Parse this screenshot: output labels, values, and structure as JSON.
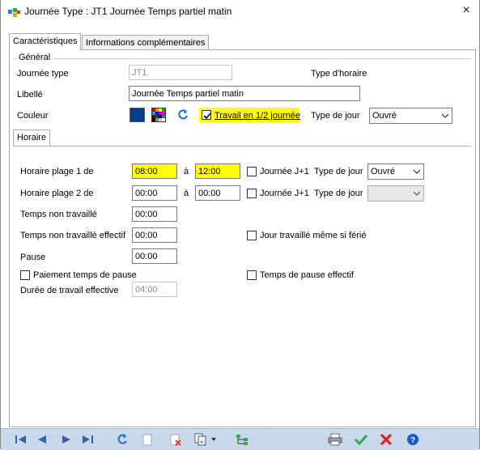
{
  "window": {
    "title": "Journée Type : JT1 Journée Temps partiel matin",
    "close_glyph": "×"
  },
  "tabs": [
    {
      "label": "Caractéristiques",
      "active": true
    },
    {
      "label": "Informations complémentaires",
      "active": false
    }
  ],
  "general": {
    "legend": "Général",
    "journee_type_label": "Journée type",
    "journee_type_value": "JT1",
    "type_horaire_label": "Type d'horaire",
    "libelle_label": "Libellé",
    "libelle_value": "Journée Temps partiel matin",
    "couleur_label": "Couleur",
    "couleur_value": "#003f8c",
    "travail_demi_label": "Travail en 1/2 journée",
    "travail_demi_checked": true,
    "type_jour_label": "Type de  jour",
    "type_jour_value": "Ouvré"
  },
  "horaire_tab": {
    "label": "Horaire"
  },
  "horaire": {
    "plage1_label": "Horaire plage 1 de",
    "plage1_from": "08:00",
    "plage1_a": "à",
    "plage1_to": "12:00",
    "plage1_jplus1_label": "Journée J+1",
    "plage1_type_label": "Type de jour",
    "plage1_type_value": "Ouvré",
    "plage2_label": "Horaire plage 2 de",
    "plage2_from": "00:00",
    "plage2_a": "à",
    "plage2_to": "00:00",
    "plage2_jplus1_label": "Journée J+1",
    "plage2_type_label": "Type de jour",
    "plage2_type_value": "",
    "temps_non_travaille_label": "Temps non travaillé",
    "temps_non_travaille_value": "00:00",
    "temps_non_travaille_eff_label": "Temps non travaillé effectif",
    "temps_non_travaille_eff_value": "00:00",
    "jour_travaille_ferie_label": "Jour travaillé même si férié",
    "pause_label": "Pause",
    "pause_value": "00:00",
    "paiement_pause_label": "Paiement temps de pause",
    "temps_pause_eff_label": "Temps de pause effectif",
    "duree_travail_eff_label": "Durée de travail effective",
    "duree_travail_eff_value": "04:00"
  },
  "toolbar": {
    "icons": [
      "first-record-icon",
      "previous-record-icon",
      "next-record-icon",
      "last-record-icon",
      "undo-icon",
      "new-record-icon",
      "delete-record-icon",
      "copy-icon",
      "tree-icon",
      "print-icon",
      "validate-icon",
      "cancel-icon",
      "help-icon"
    ]
  },
  "colors": {
    "highlight": "#ffff00",
    "toolbar_bg": "#c9d9ec",
    "couleur_swatch": "#003f8c"
  }
}
